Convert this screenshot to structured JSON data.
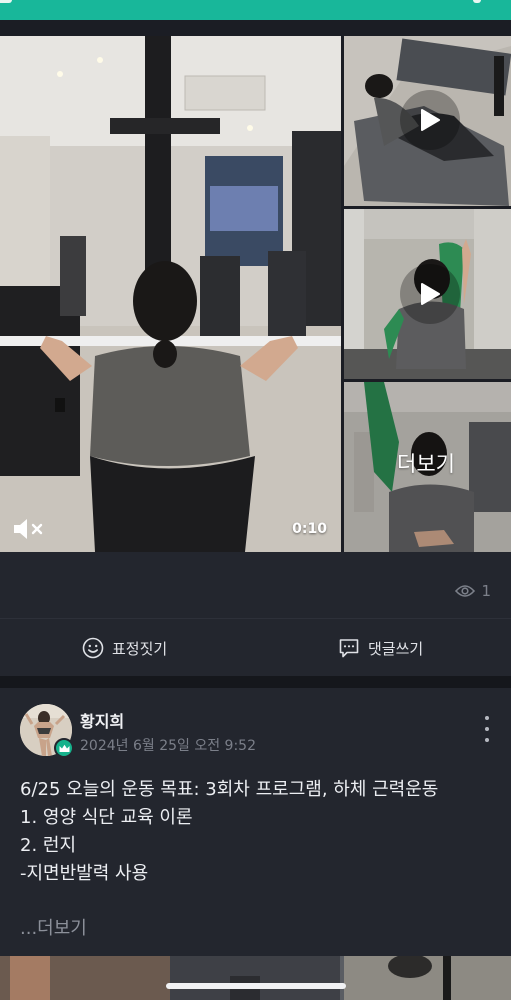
{
  "media": {
    "duration": "0:10",
    "more_label": "더보기",
    "mute_icon": "speaker-muted-icon",
    "play_icon": "play-icon"
  },
  "stats": {
    "view_count": "1",
    "view_icon": "eye-icon"
  },
  "actions": {
    "react_label": "표정짓기",
    "react_icon": "smiley-icon",
    "comment_label": "댓글쓰기",
    "comment_icon": "comment-icon"
  },
  "post": {
    "author": "황지희",
    "timestamp": "2024년 6월 25일 오전 9:52",
    "badge_icon": "crown-icon",
    "menu_icon": "more-vertical-icon",
    "body_lines": [
      "6/25 오늘의 운동 목표: 3회차 프로그램, 하체 근력운동",
      "1. 영양 식단 교육 이론",
      "2. 런지",
      "-지면반발력 사용"
    ],
    "read_more": "...더보기"
  },
  "colors": {
    "accent": "#18b79a",
    "background": "#1b1d24",
    "card": "#23262e",
    "muted_text": "#7b7f89"
  }
}
